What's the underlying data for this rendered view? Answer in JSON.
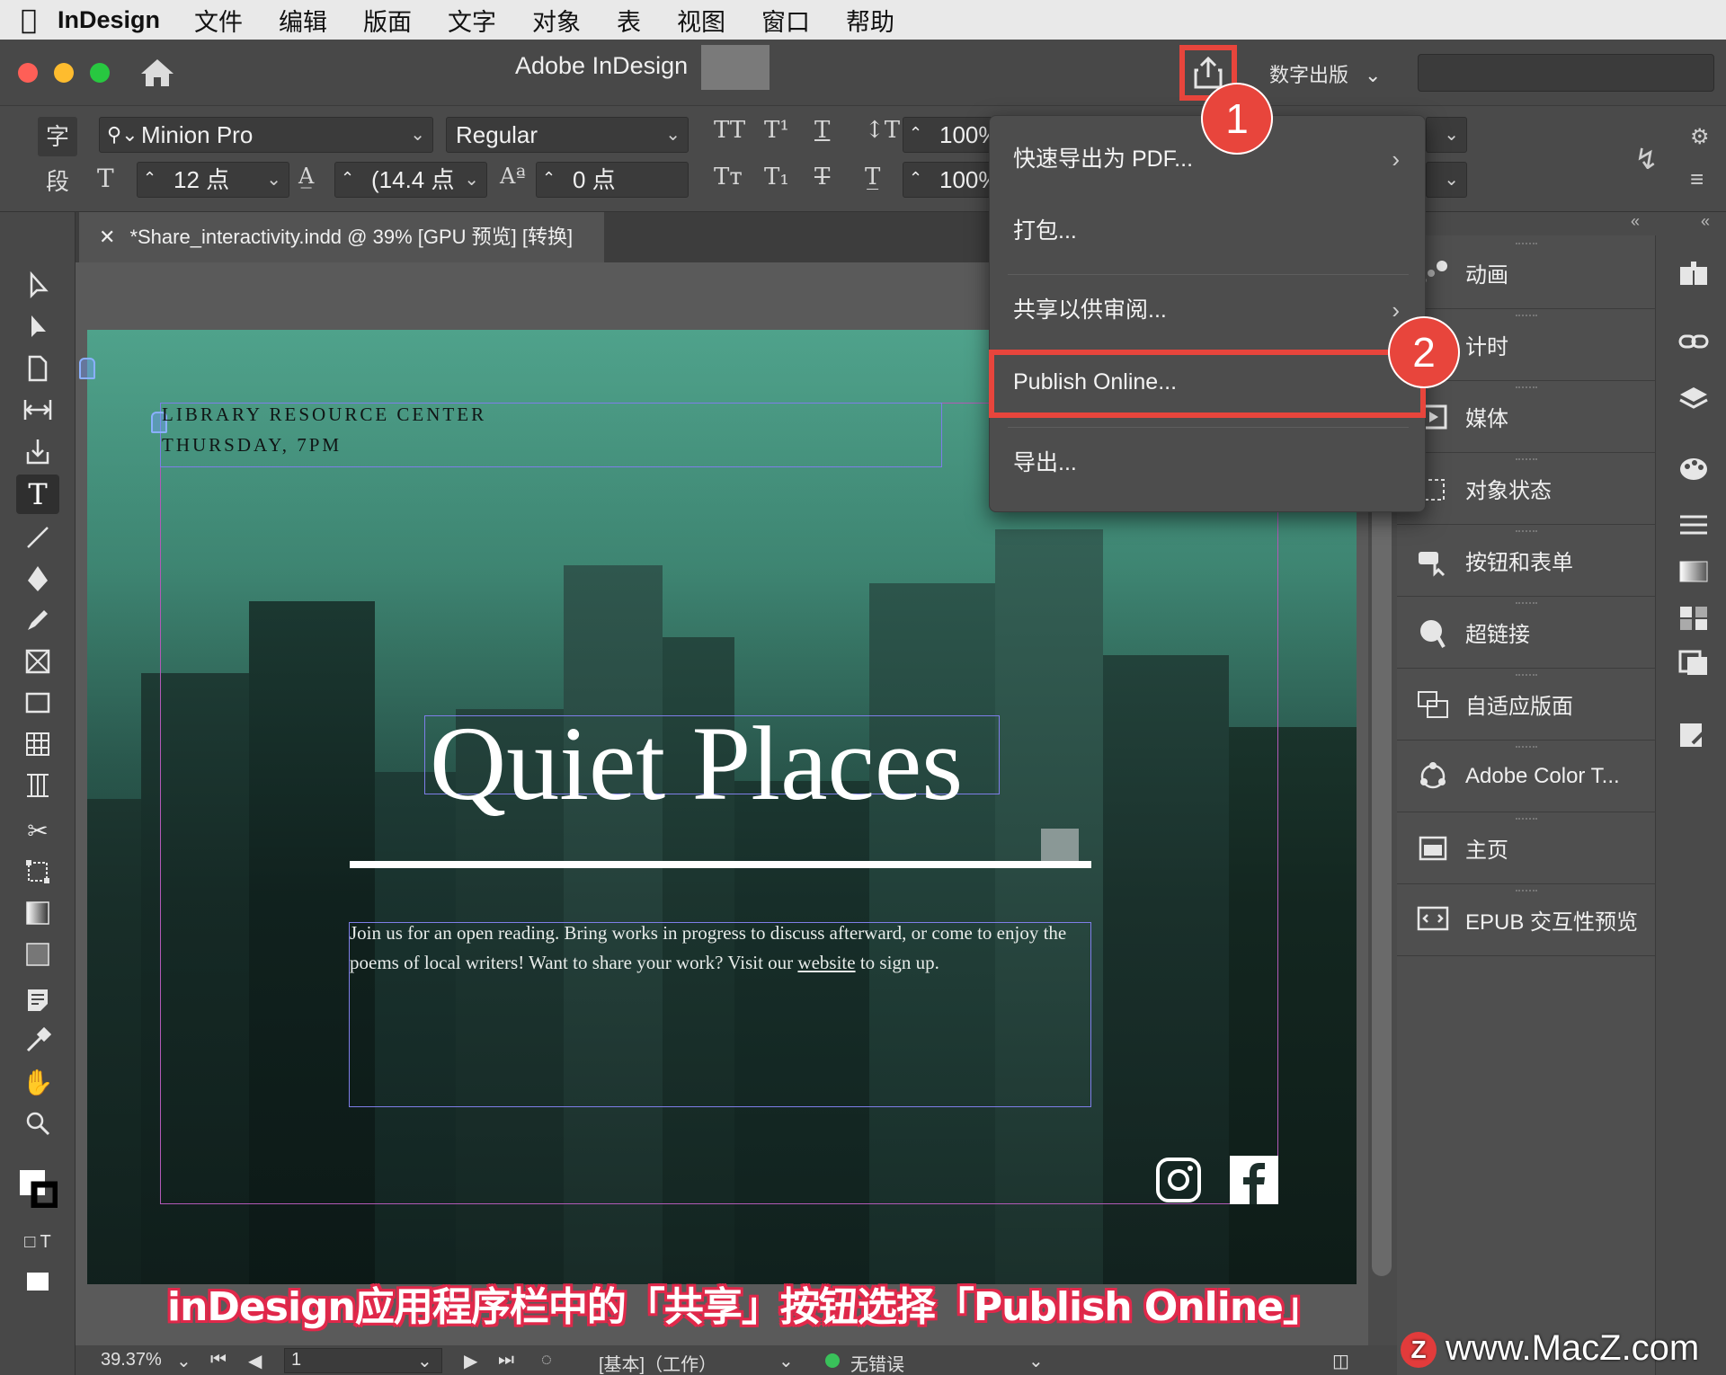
{
  "menubar": {
    "app": "InDesign",
    "items": [
      "文件",
      "编辑",
      "版面",
      "文字",
      "对象",
      "表",
      "视图",
      "窗口",
      "帮助"
    ]
  },
  "appbar": {
    "title": "Adobe InDesign",
    "workspace": "数字出版",
    "colors": {
      "close": "#fe5f57",
      "minimize": "#febc2e",
      "zoom": "#28c840",
      "callout": "#e8453c"
    }
  },
  "control_panel": {
    "char_mode": "字",
    "para_mode": "段",
    "font_family": "Minion Pro",
    "font_style": "Regular",
    "font_size": "12 点",
    "leading": "(14.4 点",
    "baseline_shift": "0 点",
    "vertical_scale": "100%",
    "horizontal_scale": "100%"
  },
  "document_tab": {
    "title": "*Share_interactivity.indd @ 39% [GPU 预览] [转换]"
  },
  "share_menu": {
    "items": [
      {
        "label": "快速导出为 PDF...",
        "submenu": true
      },
      {
        "label": "打包...",
        "submenu": false
      },
      {
        "label": "共享以供审阅...",
        "submenu": true
      },
      {
        "label": "Publish Online...",
        "submenu": false
      },
      {
        "label": "导出...",
        "submenu": false
      }
    ]
  },
  "callouts": {
    "one": "1",
    "two": "2"
  },
  "page": {
    "library_line1": "LIBRARY RESOURCE CENTER",
    "library_line2": "THURSDAY, 7PM",
    "headline": "Quiet Places",
    "body_before_link": "Join us for an open reading. Bring works in progress to discuss afterward, or come to enjoy the poems of local writers! Want to share your work? Visit our ",
    "body_link": "website",
    "body_after_link": " to sign up."
  },
  "caption": "inDesign应用程序栏中的「共享」按钮选择「Publish Online」",
  "right_panels": {
    "items": [
      {
        "label": "动画",
        "icon": "animation-icon"
      },
      {
        "label": "计时",
        "icon": "timing-icon"
      },
      {
        "label": "媒体",
        "icon": "media-icon"
      },
      {
        "label": "对象状态",
        "icon": "object-states-icon"
      },
      {
        "label": "按钮和表单",
        "icon": "buttons-forms-icon"
      },
      {
        "label": "超链接",
        "icon": "hyperlinks-icon"
      },
      {
        "label": "自适应版面",
        "icon": "liquid-layout-icon"
      },
      {
        "label": "Adobe Color T...",
        "icon": "adobe-color-icon"
      },
      {
        "label": "主页",
        "icon": "pages-icon"
      },
      {
        "label": "EPUB 交互性预览",
        "icon": "epub-preview-icon"
      }
    ]
  },
  "statusbar": {
    "zoom": "39.37%",
    "page": "1",
    "profile": "[基本]（工作）",
    "preflight": "无错误"
  },
  "watermark": "www.MacZ.com",
  "watermark_logo": "Z"
}
